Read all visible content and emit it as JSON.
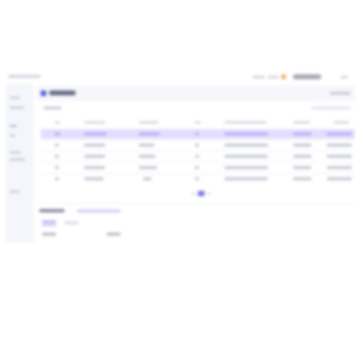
{
  "app": {
    "breadcrumb": "",
    "topbar": {
      "help_label": "",
      "notifications_label": "",
      "user_name": ""
    },
    "sidebar": {
      "items": [
        "",
        "",
        "",
        "",
        "",
        "",
        ""
      ]
    },
    "main": {
      "title": "",
      "toolbar_right": "",
      "filter_label": "",
      "filter_right": "",
      "table": {
        "headers": [
          "",
          "",
          "",
          "",
          "",
          "",
          ""
        ],
        "rows": [
          [
            "",
            "",
            "",
            "",
            "",
            "",
            ""
          ],
          [
            "",
            "",
            "",
            "",
            "",
            "",
            ""
          ],
          [
            "",
            "",
            "",
            "",
            "",
            "",
            ""
          ],
          [
            "",
            "",
            "",
            "",
            "",
            "",
            ""
          ],
          [
            "",
            "",
            "",
            "",
            "",
            "",
            ""
          ]
        ],
        "selected_row": 0
      },
      "pagination": {
        "current_page": ""
      },
      "details": {
        "title": "",
        "link": "",
        "tabs": [
          "",
          ""
        ],
        "active_tab": 0,
        "fields": [
          "",
          ""
        ]
      }
    },
    "colors": {
      "accent": "#5a5fd8",
      "selected_row_bg": "#e3defe",
      "sidebar_bg": "#f4f6fb",
      "status_orange": "#f3a54a"
    },
    "icons": {
      "title": "list-icon",
      "help": "help-icon",
      "notification": "bell-icon"
    }
  }
}
